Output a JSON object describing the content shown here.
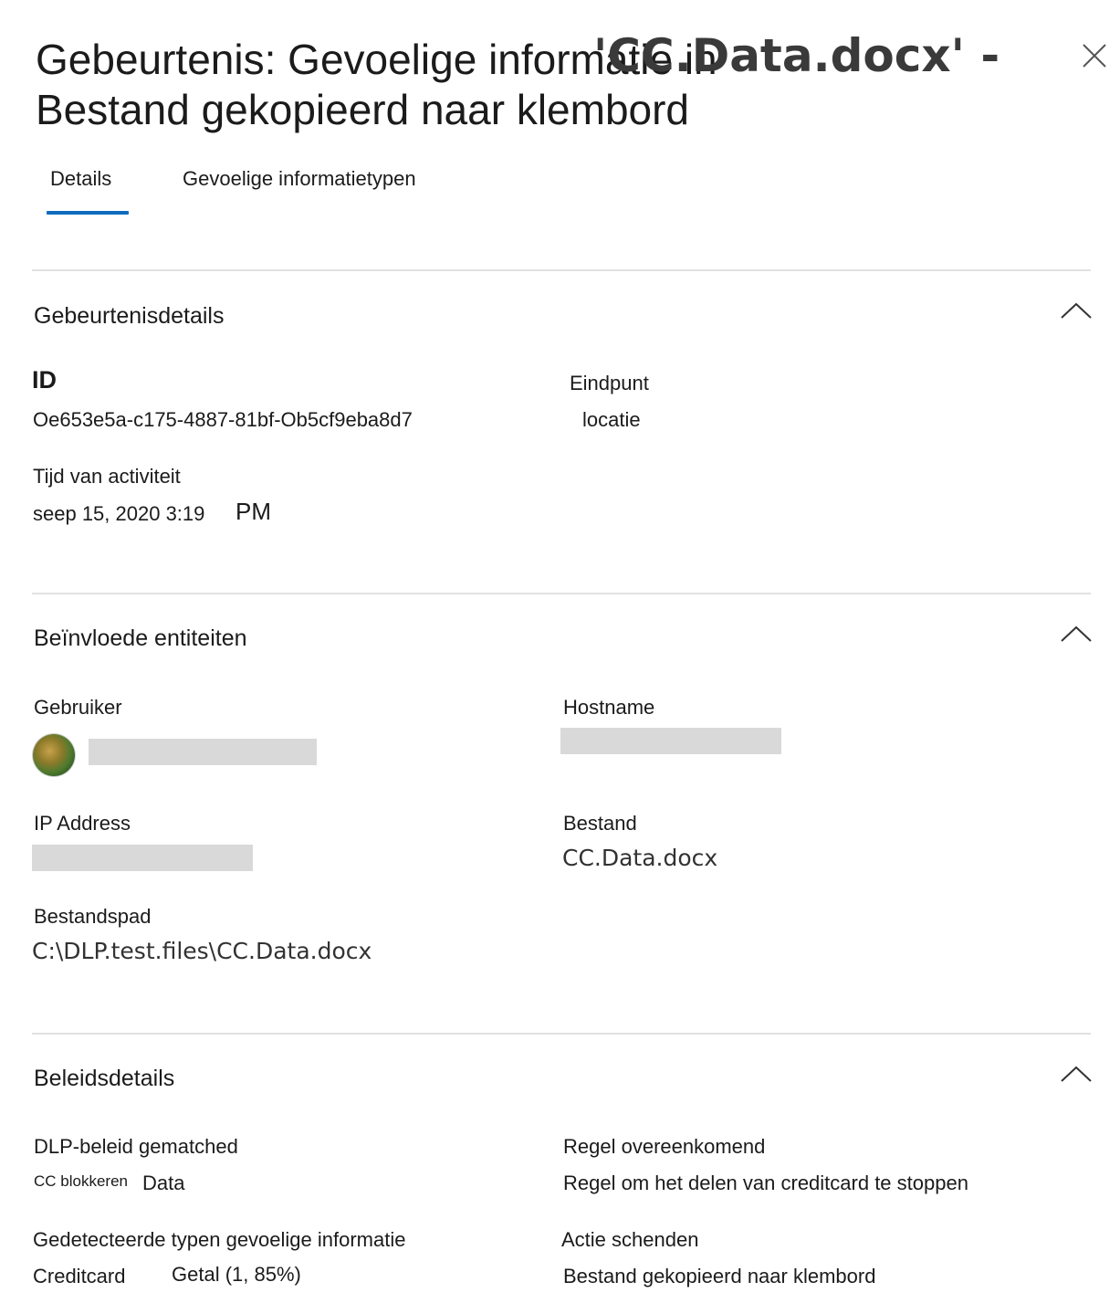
{
  "panel": {
    "title_line1": "Gebeurtenis: Gevoelige informatie in",
    "title_line2": "Bestand gekopieerd naar klembord",
    "title_overlay": "'CC.Data.docx' -",
    "close_icon": "close-icon"
  },
  "tabs": [
    {
      "label": "Details",
      "active": true
    },
    {
      "label": "Gevoelige informatietypen",
      "active": false
    }
  ],
  "event_details": {
    "section_title": "Gebeurtenisdetails",
    "id_label": "ID",
    "id_value": "Oe653e5a-c175-4887-81bf-Ob5cf9eba8d7",
    "endpoint_label": "Eindpunt",
    "endpoint_value": "locatie",
    "time_label": "Tijd van activiteit",
    "time_value": "seep 15, 2020 3:19",
    "time_ampm": "PM"
  },
  "affected_entities": {
    "section_title": "Beïnvloede entiteiten",
    "user_label": "Gebruiker",
    "hostname_label": "Hostname",
    "ip_label": "IP Address",
    "file_label": "Bestand",
    "file_value": "CC.Data.docx",
    "path_label": "Bestandspad",
    "path_value": "C:\\DLP.test.files\\CC.Data.docx"
  },
  "policy_details": {
    "section_title": "Beleidsdetails",
    "dlp_label": "DLP-beleid gematched",
    "dlp_value_a": "CC blokkeren",
    "dlp_value_b": "Data",
    "rule_label": "Regel overeenkomend",
    "rule_value": "Regel om het delen van creditcard te stoppen",
    "types_label": "Gedetecteerde typen gevoelige informatie",
    "types_value_a": "Creditcard",
    "types_value_b": "Getal (1, 85%)",
    "action_label": "Actie schenden",
    "action_value": "Bestand gekopieerd naar klembord"
  },
  "colors": {
    "accent": "#0f6cbd",
    "divider": "#e1e1e1",
    "redaction": "#d9d9d9"
  }
}
